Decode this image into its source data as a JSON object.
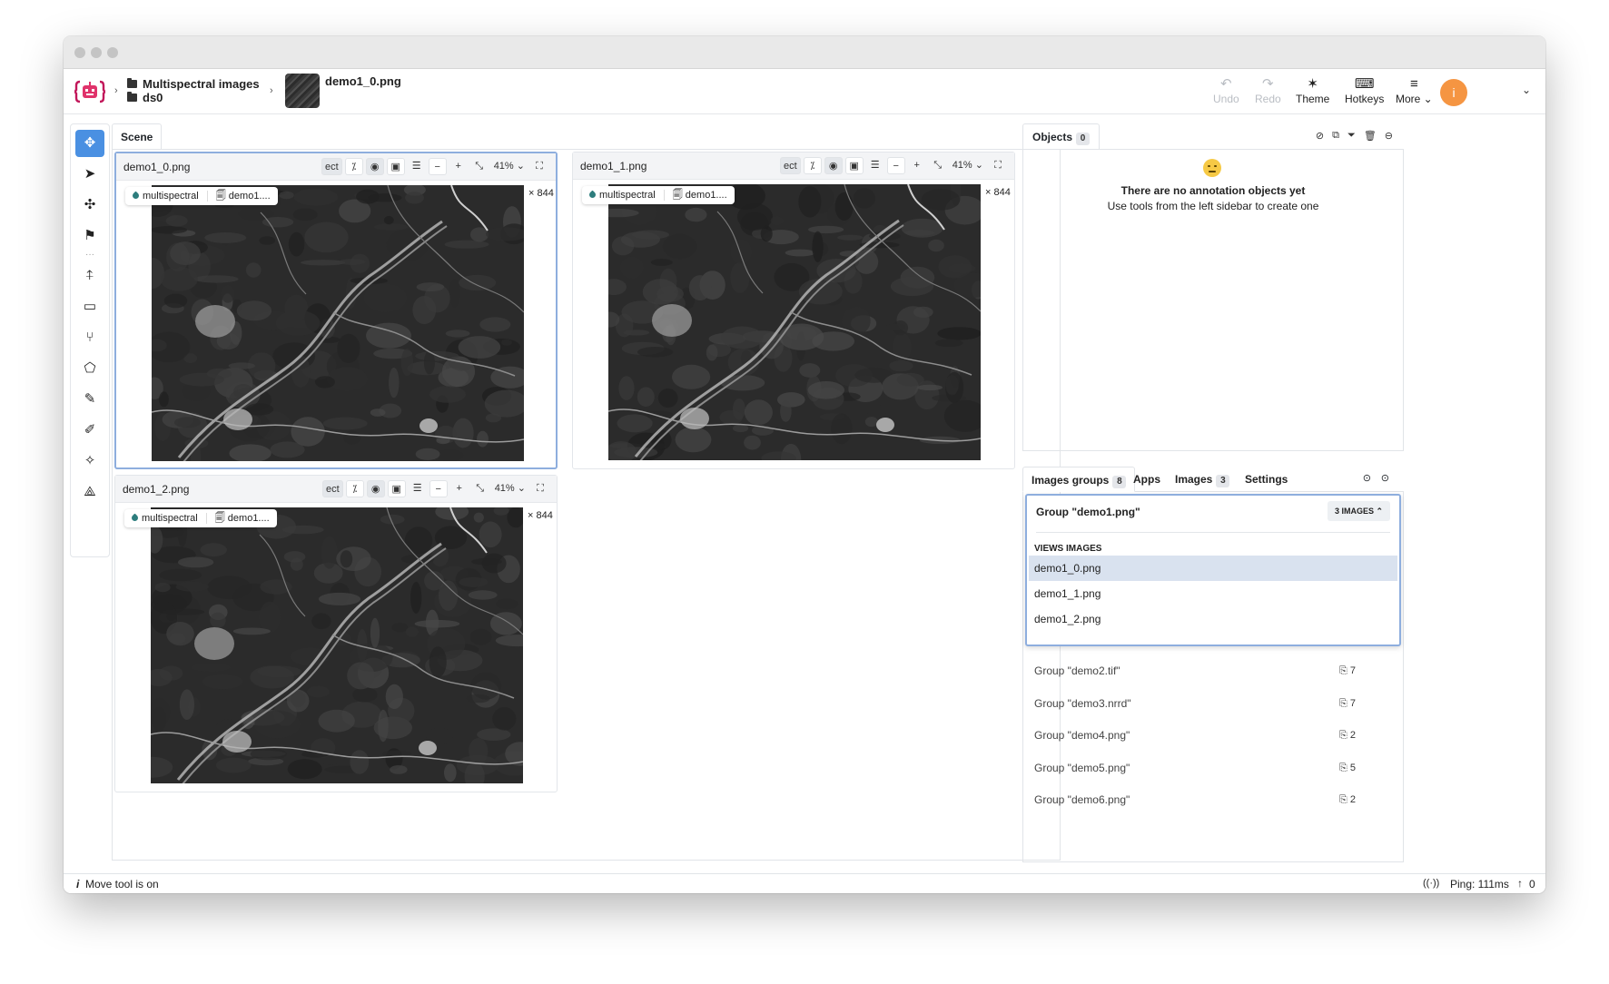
{
  "breadcrumb": {
    "project": "Multispectral images",
    "dataset": "ds0",
    "image": "demo1_0.png"
  },
  "toolbar": {
    "undo": "Undo",
    "redo": "Redo",
    "theme": "Theme",
    "hotkeys": "Hotkeys",
    "more": "More",
    "avatar_initial": "i"
  },
  "scene": {
    "tab": "Scene"
  },
  "views": [
    {
      "name": "demo1_0.png",
      "tag": "multispectral",
      "file": "demo1....",
      "size": "× 844",
      "zoom": "41%",
      "ect": "ect"
    },
    {
      "name": "demo1_1.png",
      "tag": "multispectral",
      "file": "demo1....",
      "size": "× 844",
      "zoom": "41%",
      "ect": "ect"
    },
    {
      "name": "demo1_2.png",
      "tag": "multispectral",
      "file": "demo1....",
      "size": "× 844",
      "zoom": "41%",
      "ect": "ect"
    }
  ],
  "objects": {
    "tab": "Objects",
    "count": "0",
    "empty_title": "There are no annotation objects yet",
    "empty_sub": "Use tools from the left sidebar to create one"
  },
  "groups_panel": {
    "tabs": [
      {
        "label": "Images groups",
        "badge": "8"
      },
      {
        "label": "Apps"
      },
      {
        "label": "Images",
        "badge": "3"
      },
      {
        "label": "Settings"
      }
    ],
    "expanded": {
      "title": "Group \"demo1.png\"",
      "count": "3 IMAGES",
      "views_label": "VIEWS IMAGES",
      "items": [
        "demo1_0.png",
        "demo1_1.png",
        "demo1_2.png"
      ]
    },
    "groups": [
      {
        "name": "Group \"demo2.tif\"",
        "count": "7"
      },
      {
        "name": "Group \"demo3.nrrd\"",
        "count": "7"
      },
      {
        "name": "Group \"demo4.png\"",
        "count": "2"
      },
      {
        "name": "Group \"demo5.png\"",
        "count": "5"
      },
      {
        "name": "Group \"demo6.png\"",
        "count": "2"
      }
    ]
  },
  "status": {
    "left": "Move tool is on",
    "ping": "Ping: 111ms",
    "uploads": "0"
  }
}
